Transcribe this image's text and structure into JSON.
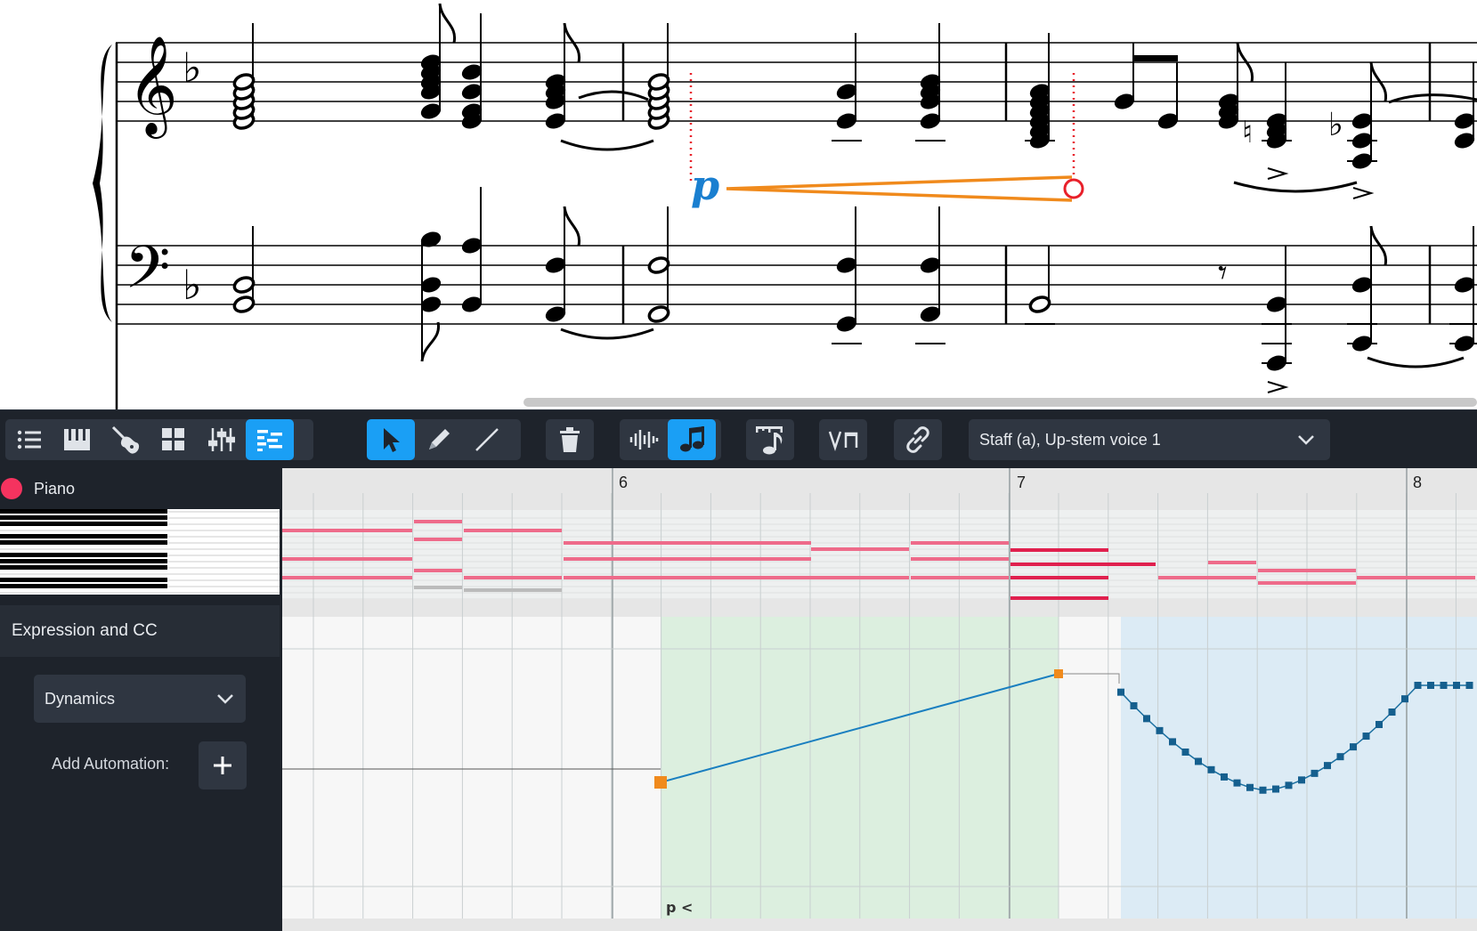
{
  "toolbar": {
    "groups": [
      [
        "list-icon",
        "piano-keys-icon",
        "guitar-icon",
        "grid-icon",
        "mixer-sliders-icon",
        "piano-roll-icon"
      ],
      [
        "select-arrow-icon",
        "pencil-icon",
        "line-icon"
      ],
      [
        "trash-icon"
      ],
      [
        "waveform-icon",
        "music-note-icon"
      ],
      [
        "note-ruler-icon"
      ],
      [
        "bowing-icon"
      ],
      [
        "link-icon"
      ]
    ],
    "active": [
      "piano-roll-icon",
      "select-arrow-icon",
      "music-note-icon"
    ],
    "staff_voice": "Staff (a), Up-stem voice 1",
    "accent_color": "#1a9ff5"
  },
  "sidebar": {
    "instrument": "Piano",
    "instrument_color": "#f5335f",
    "section_header": "Expression and CC",
    "lane_type": "Dynamics",
    "add_automation_label": "Add Automation:",
    "add_automation_button": "+"
  },
  "editor": {
    "bar_numbers": [
      "6",
      "7",
      "8"
    ],
    "dynamic_label": "p <"
  },
  "score": {
    "dynamic": "p",
    "key_signature": "one flat (F major)",
    "colors": {
      "dynamic": "#1a7fd0",
      "hairpin": "#f08a1c",
      "handle": "#e8202a"
    }
  }
}
